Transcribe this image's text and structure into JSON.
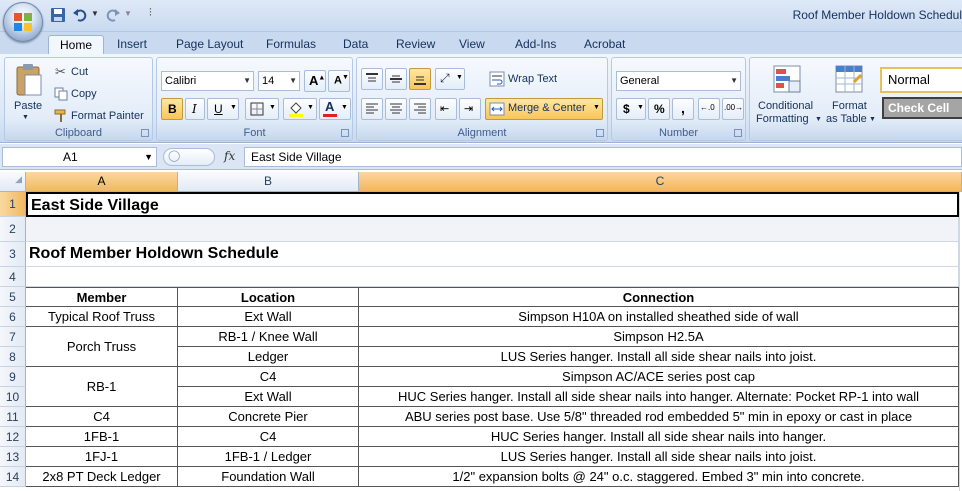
{
  "app": {
    "window_title": "Roof Member Holdown Schedul"
  },
  "tabs": [
    "Home",
    "Insert",
    "Page Layout",
    "Formulas",
    "Data",
    "Review",
    "View",
    "Add-Ins",
    "Acrobat"
  ],
  "ribbon": {
    "clipboard": {
      "paste": "Paste",
      "cut": "Cut",
      "copy": "Copy",
      "format_painter": "Format Painter",
      "label": "Clipboard"
    },
    "font": {
      "name": "Calibri",
      "size": "14",
      "bold": "B",
      "italic": "I",
      "underline": "U",
      "label": "Font"
    },
    "alignment": {
      "wrap_text": "Wrap Text",
      "merge_center": "Merge & Center",
      "label": "Alignment"
    },
    "number": {
      "format": "General",
      "currency": "$",
      "percent": "%",
      "comma": ",",
      "label": "Number"
    },
    "styles": {
      "conditional": "Conditional",
      "formatting": "Formatting",
      "format": "Format",
      "as_table": "as Table",
      "normal": "Normal",
      "check_cell": "Check Cell"
    }
  },
  "formula_bar": {
    "name_box": "A1",
    "fx": "fx",
    "content": "East Side Village"
  },
  "columns": [
    "A",
    "B",
    "C"
  ],
  "rows": [
    "1",
    "2",
    "3",
    "4",
    "5",
    "6",
    "7",
    "8",
    "9",
    "10",
    "11",
    "12",
    "13",
    "14"
  ],
  "sheet": {
    "title": "East Side Village",
    "subtitle": "Roof Member Holdown Schedule",
    "headers": {
      "member": "Member",
      "location": "Location",
      "connection": "Connection"
    },
    "members": {
      "r6": "Typical Roof Truss",
      "r7_8": "Porch Truss",
      "r9_10": "RB-1",
      "r11": "C4",
      "r12": "1FB-1",
      "r13": "1FJ-1",
      "r14": "2x8 PT Deck Ledger"
    },
    "locations": [
      "Ext Wall",
      "RB-1 / Knee Wall",
      "Ledger",
      "C4",
      "Ext Wall",
      "Concrete Pier",
      "C4",
      "1FB-1 / Ledger",
      "Foundation Wall"
    ],
    "connections": [
      "Simpson H10A on installed sheathed side of wall",
      "Simpson H2.5A",
      "LUS Series hanger. Install all side shear nails into joist.",
      "Simpson AC/ACE series post cap",
      "HUC Series hanger. Install all side shear nails into hanger. Alternate: Pocket RP-1 into wall",
      "ABU series post base. Use 5/8\" threaded rod embedded 5\" min in epoxy or cast in place",
      "HUC Series hanger. Install all side shear nails into hanger.",
      "LUS Series hanger. Install all side shear nails into joist.",
      "1/2\" expansion bolts @ 24\" o.c. staggered. Embed 3\" min into concrete."
    ]
  }
}
